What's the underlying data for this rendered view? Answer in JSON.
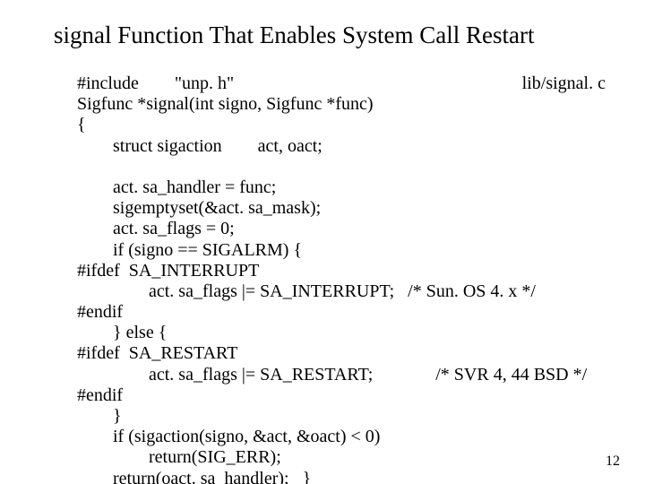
{
  "title": "signal Function That Enables System Call Restart",
  "file_label": "lib/signal. c",
  "page_number": "12",
  "code": {
    "l01": "#include        \"unp. h\"",
    "l02": "Sigfunc *signal(int signo, Sigfunc *func)",
    "l03": "{",
    "l04": "        struct sigaction        act, oact;",
    "l05": "",
    "l06": "        act. sa_handler = func;",
    "l07": "        sigemptyset(&act. sa_mask);",
    "l08": "        act. sa_flags = 0;",
    "l09": "        if (signo == SIGALRM) {",
    "l10": "#ifdef  SA_INTERRUPT",
    "l11": "                act. sa_flags |= SA_INTERRUPT;   /* Sun. OS 4. x */",
    "l12": "#endif",
    "l13": "        } else {",
    "l14": "#ifdef  SA_RESTART",
    "l15": "                act. sa_flags |= SA_RESTART;              /* SVR 4, 44 BSD */",
    "l16": "#endif",
    "l17": "        }",
    "l18": "        if (sigaction(signo, &act, &oact) < 0)",
    "l19": "                return(SIG_ERR);",
    "l20": "        return(oact. sa_handler);   }"
  }
}
